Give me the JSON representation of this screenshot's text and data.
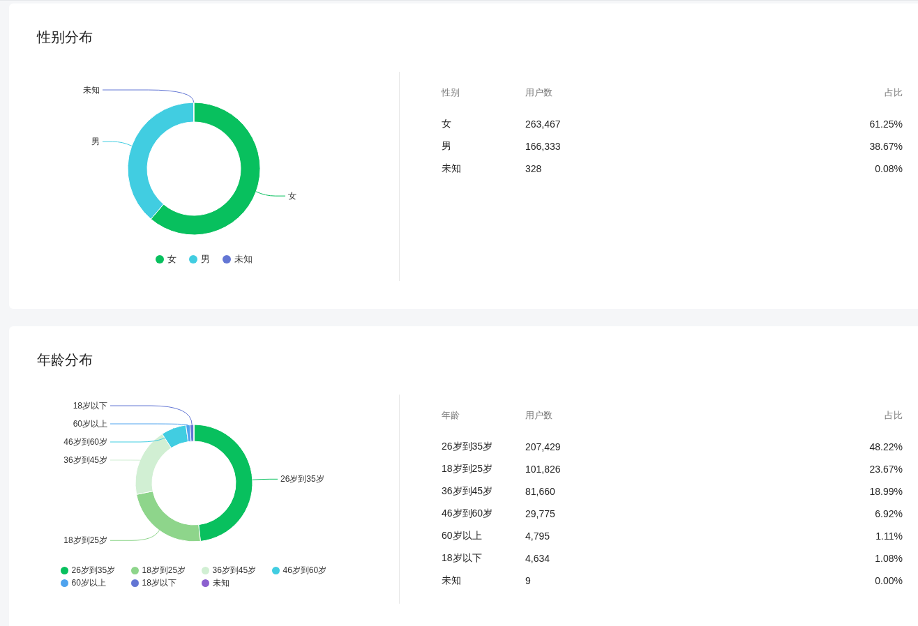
{
  "sections": [
    {
      "title": "性别分布",
      "chart": {
        "chart_data": {
          "type": "donut",
          "categories": [
            "女",
            "男",
            "未知"
          ],
          "values": [
            61.25,
            38.67,
            0.08
          ],
          "legend": "bottom"
        },
        "legend": [
          {
            "color": "#08c05e"
          },
          {
            "color": "#41cde1"
          },
          {
            "color": "#6376d4"
          }
        ]
      },
      "table": {
        "columns": [
          "性别",
          "用户数",
          "占比"
        ],
        "rows": [
          [
            "女",
            "263,467",
            "61.25%"
          ],
          [
            "男",
            "166,333",
            "38.67%"
          ],
          [
            "未知",
            "328",
            "0.08%"
          ]
        ]
      }
    },
    {
      "title": "年龄分布",
      "chart": {
        "chart_data": {
          "type": "donut",
          "categories": [
            "26岁到35岁",
            "18岁到25岁",
            "36岁到45岁",
            "46岁到60岁",
            "60岁以上",
            "18岁以下",
            "未知"
          ],
          "values": [
            48.22,
            23.67,
            18.99,
            6.92,
            1.11,
            1.08,
            0.0
          ],
          "legend": "bottom"
        },
        "legend": [
          {
            "color": "#08c05e"
          },
          {
            "color": "#8ed58b"
          },
          {
            "color": "#d1efd3"
          },
          {
            "color": "#41cde1"
          },
          {
            "color": "#4fa3ee"
          },
          {
            "color": "#6376d4"
          },
          {
            "color": "#8c60cf"
          }
        ]
      },
      "table": {
        "columns": [
          "年龄",
          "用户数",
          "占比"
        ],
        "rows": [
          [
            "26岁到35岁",
            "207,429",
            "48.22%"
          ],
          [
            "18岁到25岁",
            "101,826",
            "23.67%"
          ],
          [
            "36岁到45岁",
            "81,660",
            "18.99%"
          ],
          [
            "46岁到60岁",
            "29,775",
            "6.92%"
          ],
          [
            "60岁以上",
            "4,795",
            "1.11%"
          ],
          [
            "18岁以下",
            "4,634",
            "1.08%"
          ],
          [
            "未知",
            "9",
            "0.00%"
          ]
        ]
      }
    }
  ]
}
